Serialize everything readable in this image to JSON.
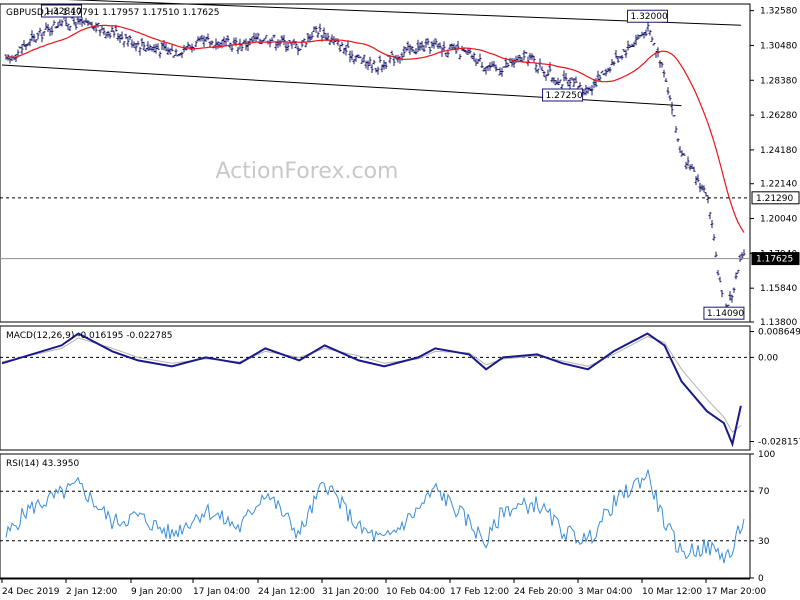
{
  "chart_data": [
    {
      "type": "candlestick",
      "panel": "price",
      "title": "GBPUSD,H4  1.17791 1.17957 1.17510 1.17625",
      "watermark": "ActionForex.com",
      "ylim": [
        1.138,
        1.3298
      ],
      "y_ticks": [
        "1.32580",
        "1.30480",
        "1.28380",
        "1.26280",
        "1.24180",
        "1.22140",
        "1.20040",
        "1.17940",
        "1.15840",
        "1.13800"
      ],
      "time_range": [
        "24 Dec 2019",
        "20 Mar 2020"
      ],
      "close_path": [
        [
          "24 Dec 2019",
          1.293
        ],
        [
          "27 Dec 2019",
          1.306
        ],
        [
          "31 Dec 2019",
          1.32
        ],
        [
          "2 Jan 2020",
          1.318
        ],
        [
          "6 Jan 2020",
          1.313
        ],
        [
          "9 Jan 2020",
          1.306
        ],
        [
          "13 Jan 2020",
          1.301
        ],
        [
          "17 Jan 2020",
          1.307
        ],
        [
          "21 Jan 2020",
          1.305
        ],
        [
          "24 Jan 2020",
          1.31
        ],
        [
          "28 Jan 2020",
          1.304
        ],
        [
          "30 Jan 2020",
          1.315
        ],
        [
          "3 Feb 2020",
          1.3
        ],
        [
          "6 Feb 2020",
          1.292
        ],
        [
          "10 Feb 2020",
          1.302
        ],
        [
          "13 Feb 2020",
          1.305
        ],
        [
          "17 Feb 2020",
          1.299
        ],
        [
          "20 Feb 2020",
          1.29
        ],
        [
          "24 Feb 2020",
          1.298
        ],
        [
          "27 Feb 2020",
          1.285
        ],
        [
          "2 Mar 2020",
          1.278
        ],
        [
          "5 Mar 2020",
          1.295
        ],
        [
          "9 Mar 2020",
          1.315
        ],
        [
          "11 Mar 2020",
          1.29
        ],
        [
          "13 Mar 2020",
          1.238
        ],
        [
          "16 Mar 2020",
          1.215
        ],
        [
          "18 Mar 2020",
          1.145
        ],
        [
          "19 Mar 2020",
          1.155
        ],
        [
          "20 Mar 2020",
          1.1762
        ]
      ],
      "moving_average_color": "#e8141b",
      "bar_color": "#1a1a6e",
      "trendlines": [
        {
          "from": [
            "24 Dec 2019",
            1.334
          ],
          "to": [
            "20 Mar 2020",
            1.317
          ]
        },
        {
          "from": [
            "24 Dec 2019",
            1.293
          ],
          "to": [
            "13 Mar 2020",
            1.2685
          ]
        }
      ],
      "horizontal_levels": [
        {
          "value": 1.2129,
          "label": "1.21290",
          "style": "dashed"
        },
        {
          "value": 1.17625,
          "label": "1.17625",
          "style": "solid-grey",
          "current_price": true
        }
      ],
      "annotations": [
        {
          "text": "1.32840",
          "x": "31 Dec 2019",
          "y": 1.3284
        },
        {
          "text": "1.32000",
          "x": "9 Mar 2020",
          "y": 1.32
        },
        {
          "text": "1.27250",
          "x": "28 Feb 2020",
          "y": 1.2725
        },
        {
          "text": "1.14090",
          "x": "18 Mar 2020",
          "y": 1.1409
        }
      ]
    },
    {
      "type": "line",
      "panel": "macd",
      "title": "MACD(12,26,9) -0.016195 -0.022785",
      "ylim": [
        -0.031,
        0.0105
      ],
      "y_ticks": [
        "0.008649",
        "0.00",
        "-0.028157"
      ],
      "series": [
        {
          "name": "MACD",
          "color": "#1a1a8a",
          "points": [
            [
              "24 Dec 2019",
              -0.002
            ],
            [
              "31 Dec 2019",
              0.004
            ],
            [
              "2 Jan 2020",
              0.008
            ],
            [
              "6 Jan 2020",
              0.002
            ],
            [
              "9 Jan 2020",
              -0.001
            ],
            [
              "13 Jan 2020",
              -0.003
            ],
            [
              "17 Jan 2020",
              0.0
            ],
            [
              "21 Jan 2020",
              -0.002
            ],
            [
              "24 Jan 2020",
              0.003
            ],
            [
              "28 Jan 2020",
              -0.001
            ],
            [
              "31 Jan 2020",
              0.004
            ],
            [
              "4 Feb 2020",
              -0.001
            ],
            [
              "7 Feb 2020",
              -0.003
            ],
            [
              "11 Feb 2020",
              0.0
            ],
            [
              "13 Feb 2020",
              0.003
            ],
            [
              "17 Feb 2020",
              0.001
            ],
            [
              "19 Feb 2020",
              -0.004
            ],
            [
              "21 Feb 2020",
              0.0
            ],
            [
              "25 Feb 2020",
              0.001
            ],
            [
              "28 Feb 2020",
              -0.002
            ],
            [
              "2 Mar 2020",
              -0.004
            ],
            [
              "5 Mar 2020",
              0.002
            ],
            [
              "9 Mar 2020",
              0.008
            ],
            [
              "11 Mar 2020",
              0.004
            ],
            [
              "13 Mar 2020",
              -0.008
            ],
            [
              "16 Mar 2020",
              -0.018
            ],
            [
              "18 Mar 2020",
              -0.022
            ],
            [
              "19 Mar 2020",
              -0.029
            ],
            [
              "20 Mar 2020",
              -0.0162
            ]
          ]
        },
        {
          "name": "Signal",
          "color": "#b4b4b4",
          "points": [
            [
              "24 Dec 2019",
              -0.0015
            ],
            [
              "31 Dec 2019",
              0.003
            ],
            [
              "2 Jan 2020",
              0.0065
            ],
            [
              "6 Jan 2020",
              0.003
            ],
            [
              "9 Jan 2020",
              0.0
            ],
            [
              "13 Jan 2020",
              -0.002
            ],
            [
              "17 Jan 2020",
              -0.0005
            ],
            [
              "21 Jan 2020",
              -0.0015
            ],
            [
              "24 Jan 2020",
              0.002
            ],
            [
              "28 Jan 2020",
              0.0
            ],
            [
              "31 Jan 2020",
              0.003
            ],
            [
              "4 Feb 2020",
              0.0005
            ],
            [
              "7 Feb 2020",
              -0.002
            ],
            [
              "11 Feb 2020",
              -0.0005
            ],
            [
              "13 Feb 2020",
              0.002
            ],
            [
              "17 Feb 2020",
              0.0015
            ],
            [
              "19 Feb 2020",
              -0.0025
            ],
            [
              "21 Feb 2020",
              -0.0005
            ],
            [
              "25 Feb 2020",
              0.0005
            ],
            [
              "28 Feb 2020",
              -0.0012
            ],
            [
              "2 Mar 2020",
              -0.003
            ],
            [
              "5 Mar 2020",
              0.001
            ],
            [
              "9 Mar 2020",
              0.007
            ],
            [
              "11 Mar 2020",
              0.005
            ],
            [
              "13 Mar 2020",
              -0.004
            ],
            [
              "16 Mar 2020",
              -0.014
            ],
            [
              "18 Mar 2020",
              -0.02
            ],
            [
              "19 Mar 2020",
              -0.025
            ],
            [
              "20 Mar 2020",
              -0.0228
            ]
          ]
        }
      ]
    },
    {
      "type": "line",
      "panel": "rsi",
      "title": "RSI(14) 43.3950",
      "ylim": [
        0,
        100
      ],
      "y_ticks": [
        "100",
        "70",
        "30",
        "0"
      ],
      "reference_levels": [
        70,
        30
      ],
      "series": [
        {
          "name": "RSI",
          "color": "#3a8fd6",
          "points": [
            [
              "24 Dec 2019",
              30
            ],
            [
              "27 Dec 2019",
              55
            ],
            [
              "31 Dec 2019",
              68
            ],
            [
              "2 Jan 2020",
              75
            ],
            [
              "6 Jan 2020",
              45
            ],
            [
              "9 Jan 2020",
              50
            ],
            [
              "13 Jan 2020",
              35
            ],
            [
              "17 Jan 2020",
              55
            ],
            [
              "21 Jan 2020",
              40
            ],
            [
              "24 Jan 2020",
              70
            ],
            [
              "28 Jan 2020",
              35
            ],
            [
              "31 Jan 2020",
              78
            ],
            [
              "4 Feb 2020",
              40
            ],
            [
              "7 Feb 2020",
              30
            ],
            [
              "11 Feb 2020",
              55
            ],
            [
              "13 Feb 2020",
              72
            ],
            [
              "17 Feb 2020",
              45
            ],
            [
              "19 Feb 2020",
              28
            ],
            [
              "21 Feb 2020",
              55
            ],
            [
              "25 Feb 2020",
              60
            ],
            [
              "28 Feb 2020",
              38
            ],
            [
              "2 Mar 2020",
              30
            ],
            [
              "5 Mar 2020",
              60
            ],
            [
              "9 Mar 2020",
              84
            ],
            [
              "11 Mar 2020",
              45
            ],
            [
              "13 Mar 2020",
              20
            ],
            [
              "16 Mar 2020",
              25
            ],
            [
              "18 Mar 2020",
              18
            ],
            [
              "19 Mar 2020",
              20
            ],
            [
              "20 Mar 2020",
              43.4
            ]
          ]
        }
      ]
    }
  ],
  "x_axis_labels": [
    "24 Dec 2019",
    "2 Jan 12:00",
    "9 Jan 20:00",
    "17 Jan 04:00",
    "24 Jan 12:00",
    "31 Jan 20:00",
    "10 Feb 04:00",
    "17 Feb 12:00",
    "24 Feb 20:00",
    "3 Mar 04:00",
    "10 Mar 12:00",
    "17 Mar 20:00"
  ]
}
